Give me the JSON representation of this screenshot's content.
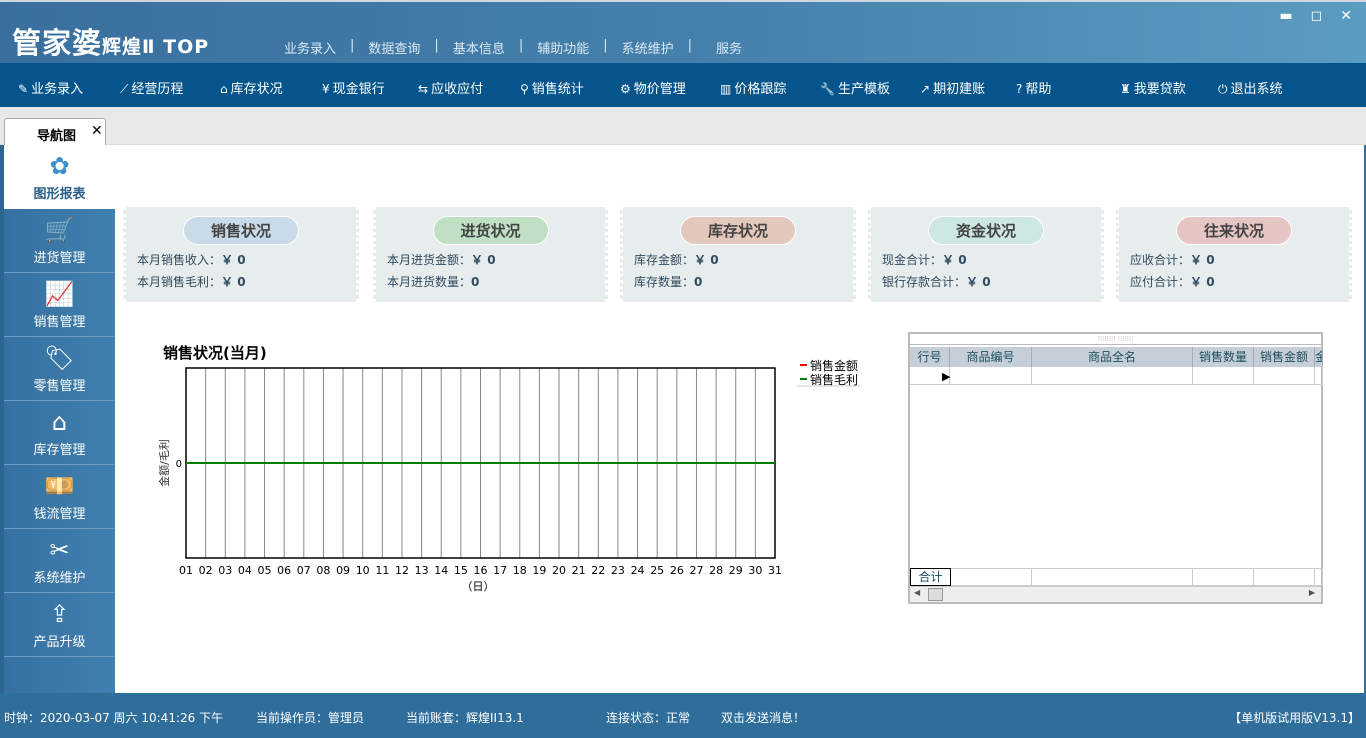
{
  "app": {
    "logo": "管家婆",
    "logo_sub": "辉煌Ⅱ TOP"
  },
  "top_menu": [
    "业务录入",
    "数据查询",
    "基本信息",
    "辅助功能",
    "系统维护",
    "服务"
  ],
  "window_controls": [
    "minimize",
    "maximize",
    "close"
  ],
  "toolbar": [
    {
      "label": "业务录入",
      "icon": "edit-icon",
      "glyph": "✎"
    },
    {
      "label": "经营历程",
      "icon": "chart-icon",
      "glyph": "⟋"
    },
    {
      "label": "库存状况",
      "icon": "home-icon",
      "glyph": "⌂"
    },
    {
      "label": "现金银行",
      "icon": "yen-icon",
      "glyph": "¥"
    },
    {
      "label": "应收应付",
      "icon": "exchange-icon",
      "glyph": "⇆"
    },
    {
      "label": "销售统计",
      "icon": "search-icon",
      "glyph": "⚲"
    },
    {
      "label": "物价管理",
      "icon": "gear-icon",
      "glyph": "⚙"
    },
    {
      "label": "价格跟踪",
      "icon": "bar-chart-icon",
      "glyph": "▥"
    },
    {
      "label": "生产模板",
      "icon": "wrench-icon",
      "glyph": "🔧"
    },
    {
      "label": "期初建账",
      "icon": "external-link-icon",
      "glyph": "↗"
    },
    {
      "label": "帮助",
      "icon": "help-icon",
      "glyph": "?"
    },
    {
      "label": "我要贷款",
      "icon": "money-bag-icon",
      "glyph": "♜"
    },
    {
      "label": "退出系统",
      "icon": "power-icon",
      "glyph": "⏻"
    }
  ],
  "tab": {
    "label": "导航图",
    "close": "✕"
  },
  "sidebar": [
    {
      "label": "图形报表",
      "icon": "grid-icon",
      "glyph": "✿",
      "active": true
    },
    {
      "label": "进货管理",
      "icon": "cart-icon",
      "glyph": "🛒"
    },
    {
      "label": "销售管理",
      "icon": "trend-icon",
      "glyph": "📈"
    },
    {
      "label": "零售管理",
      "icon": "tag-icon",
      "glyph": "🏷"
    },
    {
      "label": "库存管理",
      "icon": "house-icon",
      "glyph": "⌂"
    },
    {
      "label": "钱流管理",
      "icon": "cash-icon",
      "glyph": "💴"
    },
    {
      "label": "系统维护",
      "icon": "tools-icon",
      "glyph": "✂"
    },
    {
      "label": "产品升级",
      "icon": "upload-icon",
      "glyph": "⇪"
    }
  ],
  "cards": [
    {
      "title": "销售状况",
      "color": "#c9dbe8",
      "rows": [
        {
          "label": "本月销售收入：",
          "value": "￥ 0"
        },
        {
          "label": "本月销售毛利：",
          "value": "￥ 0"
        }
      ]
    },
    {
      "title": "进货状况",
      "color": "#bfe0c5",
      "rows": [
        {
          "label": "本月进货金额：",
          "value": "￥ 0"
        },
        {
          "label": "本月进货数量：",
          "value": "0"
        }
      ]
    },
    {
      "title": "库存状况",
      "color": "#e3c8bd",
      "rows": [
        {
          "label": "库存金额：",
          "value": "￥ 0"
        },
        {
          "label": "库存数量：",
          "value": "0"
        }
      ]
    },
    {
      "title": "资金状况",
      "color": "#cde7e2",
      "rows": [
        {
          "label": "现金合计：",
          "value": "￥ 0"
        },
        {
          "label": "银行存款合计：",
          "value": "￥ 0"
        }
      ]
    },
    {
      "title": "往来状况",
      "color": "#e6c6c4",
      "rows": [
        {
          "label": "应收合计：",
          "value": "￥ 0"
        },
        {
          "label": "应付合计：",
          "value": "￥ 0"
        }
      ]
    }
  ],
  "chart_data": {
    "type": "line",
    "title": "销售状况(当月)",
    "xlabel": "（日）",
    "ylabel": "金额/毛利",
    "x": [
      "01",
      "02",
      "03",
      "04",
      "05",
      "06",
      "07",
      "08",
      "09",
      "10",
      "11",
      "12",
      "13",
      "14",
      "15",
      "16",
      "17",
      "18",
      "19",
      "20",
      "21",
      "22",
      "23",
      "24",
      "25",
      "26",
      "27",
      "28",
      "29",
      "30",
      "31"
    ],
    "yticks": [
      "0"
    ],
    "grid": true,
    "legend": "top-right",
    "series": [
      {
        "name": "销售金额",
        "color": "#ff0000",
        "values": [
          0,
          0,
          0,
          0,
          0,
          0,
          0,
          0,
          0,
          0,
          0,
          0,
          0,
          0,
          0,
          0,
          0,
          0,
          0,
          0,
          0,
          0,
          0,
          0,
          0,
          0,
          0,
          0,
          0,
          0,
          0
        ]
      },
      {
        "name": "销售毛利",
        "color": "#008000",
        "values": [
          0,
          0,
          0,
          0,
          0,
          0,
          0,
          0,
          0,
          0,
          0,
          0,
          0,
          0,
          0,
          0,
          0,
          0,
          0,
          0,
          0,
          0,
          0,
          0,
          0,
          0,
          0,
          0,
          0,
          0,
          0
        ]
      }
    ]
  },
  "table": {
    "columns": [
      "行号",
      "商品编号",
      "商品全名",
      "销售数量",
      "销售金额",
      "金"
    ],
    "footer_label": "合计",
    "rows": []
  },
  "status": {
    "clock": "时钟：2020-03-07 周六 10:41:26 下午",
    "operator": "当前操作员：管理员",
    "account": "当前账套：辉煌II13.1",
    "connection": "连接状态：正常",
    "message": "双击发送消息！",
    "version": "【单机版试用版V13.1】"
  }
}
